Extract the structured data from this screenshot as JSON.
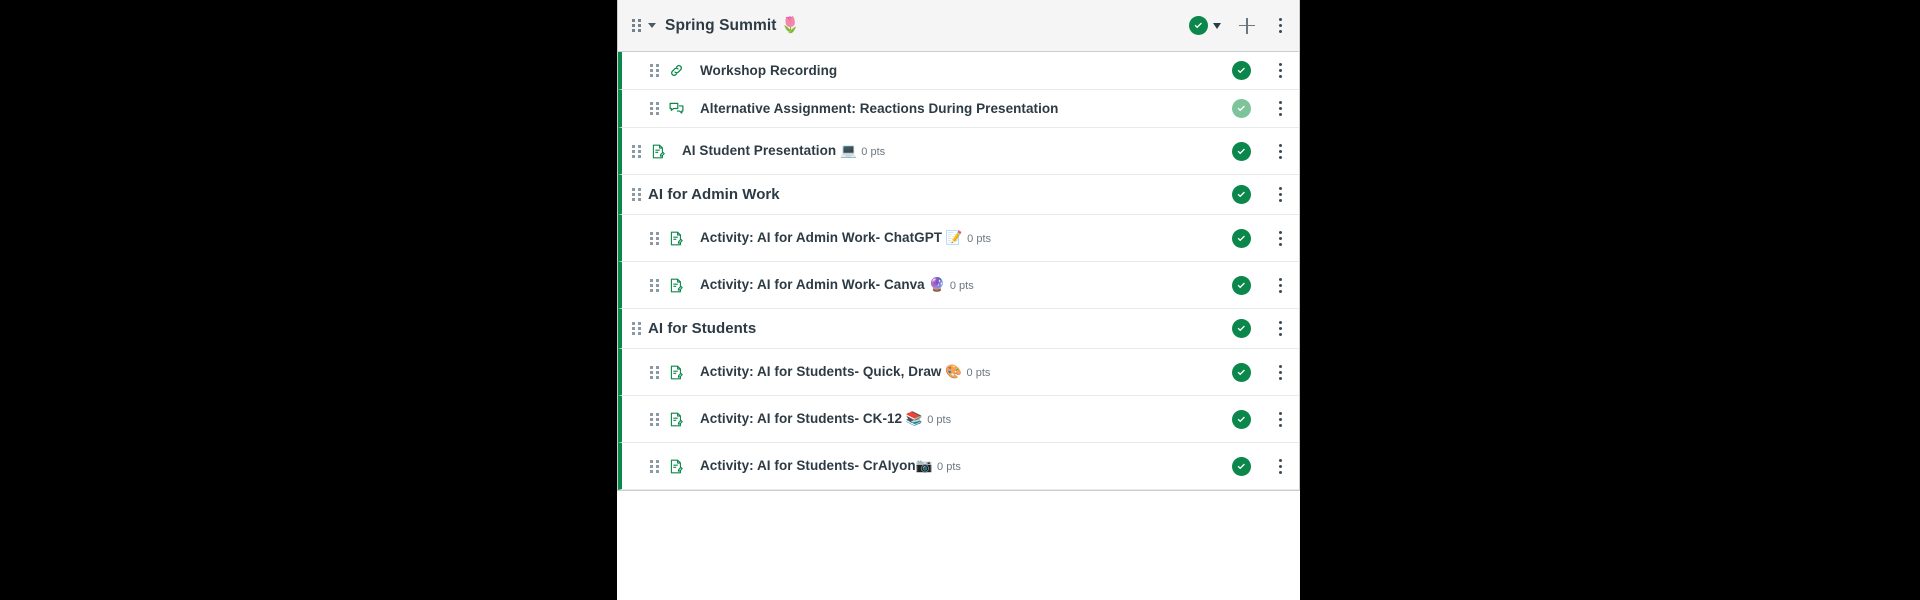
{
  "module": {
    "title": "Spring Summit 🌷",
    "collapse_icon": "chevron-down-icon",
    "drag_icon": "drag-handle-icon",
    "publish_status": "published",
    "publish_icon": "check-circle-icon",
    "add_label": "+",
    "add_icon": "plus-icon",
    "menu_icon": "kebab-menu-icon",
    "accent_color": "#0b874b",
    "muted_accent_color": "#7dc49a",
    "header_bg": "#f5f5f5",
    "text_color": "#2d3b45"
  },
  "items": [
    {
      "title": "Workshop Recording",
      "emoji": "",
      "points": "",
      "icon": "link-icon",
      "indent": 1,
      "publish_status": "published",
      "menu_icon": "kebab-menu-icon"
    },
    {
      "title": "Alternative Assignment: Reactions During Presentation",
      "emoji": "",
      "points": "",
      "icon": "discussion-icon",
      "indent": 1,
      "publish_status": "published-muted",
      "menu_icon": "kebab-menu-icon"
    },
    {
      "title": "AI Student Presentation ",
      "emoji": "💻",
      "points": "0 pts",
      "icon": "assignment-icon",
      "indent": 0,
      "publish_status": "published",
      "menu_icon": "kebab-menu-icon"
    },
    {
      "title": "AI for Admin Work",
      "emoji": "",
      "points": "",
      "icon": "",
      "indent": 0,
      "subheader": true,
      "publish_status": "published",
      "menu_icon": "kebab-menu-icon"
    },
    {
      "title": "Activity: AI for Admin Work- ChatGPT ",
      "emoji": "📝",
      "points": "0 pts",
      "icon": "assignment-icon",
      "indent": 1,
      "publish_status": "published",
      "menu_icon": "kebab-menu-icon"
    },
    {
      "title": "Activity: AI for Admin Work- Canva ",
      "emoji": "🔮",
      "points": "0 pts",
      "icon": "assignment-icon",
      "indent": 1,
      "publish_status": "published",
      "menu_icon": "kebab-menu-icon"
    },
    {
      "title": "AI for Students",
      "emoji": "",
      "points": "",
      "icon": "",
      "indent": 0,
      "subheader": true,
      "publish_status": "published",
      "menu_icon": "kebab-menu-icon"
    },
    {
      "title": "Activity: AI for Students- Quick, Draw ",
      "emoji": "🎨",
      "points": "0 pts",
      "icon": "assignment-icon",
      "indent": 1,
      "publish_status": "published",
      "menu_icon": "kebab-menu-icon"
    },
    {
      "title": "Activity: AI for Students- CK-12 ",
      "emoji": "📚",
      "points": "0 pts",
      "icon": "assignment-icon",
      "indent": 1,
      "publish_status": "published",
      "menu_icon": "kebab-menu-icon"
    },
    {
      "title": "Activity: AI for Students- CrAIyon",
      "emoji": "📷",
      "points": "0 pts",
      "icon": "assignment-icon",
      "indent": 1,
      "publish_status": "published",
      "menu_icon": "kebab-menu-icon"
    }
  ]
}
